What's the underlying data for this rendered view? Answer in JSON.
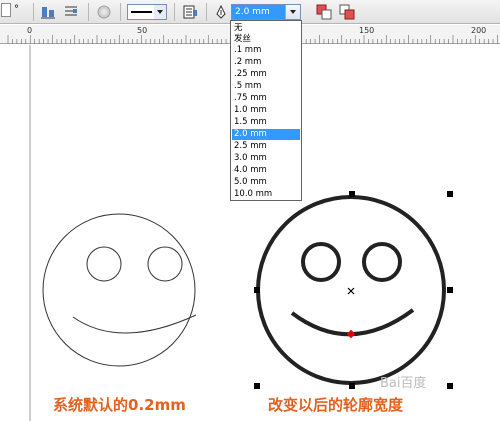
{
  "toolbar": {
    "degree_suffix": "°",
    "icons": [
      "align-icon",
      "wrap-text-icon",
      "disabled-shape-icon",
      "line-style-icon",
      "convert-icon",
      "pen-icon",
      "to-front-icon",
      "to-back-icon"
    ]
  },
  "outline_width": {
    "selected": "2.0 mm",
    "options": [
      "无",
      "发丝",
      ".1 mm",
      ".2 mm",
      ".25 mm",
      ".5 mm",
      ".75 mm",
      "1.0 mm",
      "1.5 mm",
      "2.0 mm",
      "2.5 mm",
      "3.0 mm",
      "4.0 mm",
      "5.0 mm",
      "10.0 mm"
    ],
    "selected_index": 9
  },
  "ruler": {
    "labels": [
      "0",
      "50",
      "150",
      "200"
    ]
  },
  "canvas": {
    "left_face_stroke": "thin",
    "right_face_stroke": "thick"
  },
  "captions": {
    "left": "系统默认的0.2mm",
    "right": "改变以后的轮廓宽度"
  },
  "watermark": "Bai百度",
  "colors": {
    "caption": "#e46220",
    "selection": "#3399ff",
    "node_marker": "#e00000"
  }
}
